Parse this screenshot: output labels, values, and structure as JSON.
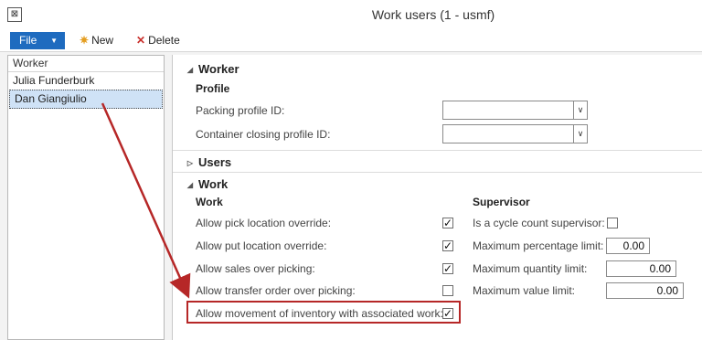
{
  "window": {
    "title": "Work users (1 - usmf)",
    "icon": "app-window-icon"
  },
  "toolbar": {
    "file_label": "File",
    "new_label": "New",
    "delete_label": "Delete"
  },
  "list": {
    "header": "Worker",
    "rows": [
      "Julia Funderburk",
      "Dan Giangiulio"
    ],
    "selected": "Dan Giangiulio"
  },
  "sections": {
    "worker": {
      "title": "Worker",
      "profile_heading": "Profile",
      "packing_label": "Packing profile ID:",
      "packing_value": "",
      "container_label": "Container closing profile ID:",
      "container_value": ""
    },
    "users": {
      "title": "Users"
    },
    "work": {
      "title": "Work",
      "work_heading": "Work",
      "supervisor_heading": "Supervisor",
      "checks": [
        {
          "label": "Allow pick location override:",
          "checked": true
        },
        {
          "label": "Allow put location override:",
          "checked": true
        },
        {
          "label": "Allow sales over picking:",
          "checked": true
        },
        {
          "label": "Allow transfer order over picking:",
          "checked": false
        },
        {
          "label": "Allow movement of inventory with associated work:",
          "checked": true
        }
      ],
      "supervisor": {
        "cycle_label": "Is a cycle count supervisor:",
        "cycle_checked": false,
        "max_pct_label": "Maximum percentage limit:",
        "max_pct_value": "0.00",
        "max_qty_label": "Maximum quantity limit:",
        "max_qty_value": "0.00",
        "max_val_label": "Maximum value limit:",
        "max_val_value": "0.00"
      }
    }
  },
  "colors": {
    "accent": "#1e6bbf",
    "selection": "#cfe2f6",
    "annotation": "#b62727"
  }
}
